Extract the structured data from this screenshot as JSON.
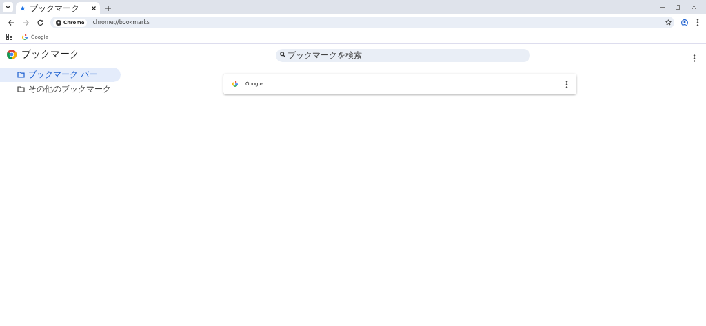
{
  "tabs": [
    {
      "title": "ブックマーク",
      "selected": true
    }
  ],
  "address_bar": {
    "chip": "Chrome",
    "url": "chrome://bookmarks"
  },
  "bookmarks_bar": [
    {
      "label": "Google"
    }
  ],
  "page": {
    "title": "ブックマーク",
    "search": {
      "placeholder": "ブックマークを検索"
    }
  },
  "sidebar": {
    "items": [
      {
        "label": "ブックマーク バー",
        "selected": true
      },
      {
        "label": "その他のブックマーク",
        "selected": false
      }
    ]
  },
  "bookmarks": [
    {
      "title": "Google"
    }
  ]
}
